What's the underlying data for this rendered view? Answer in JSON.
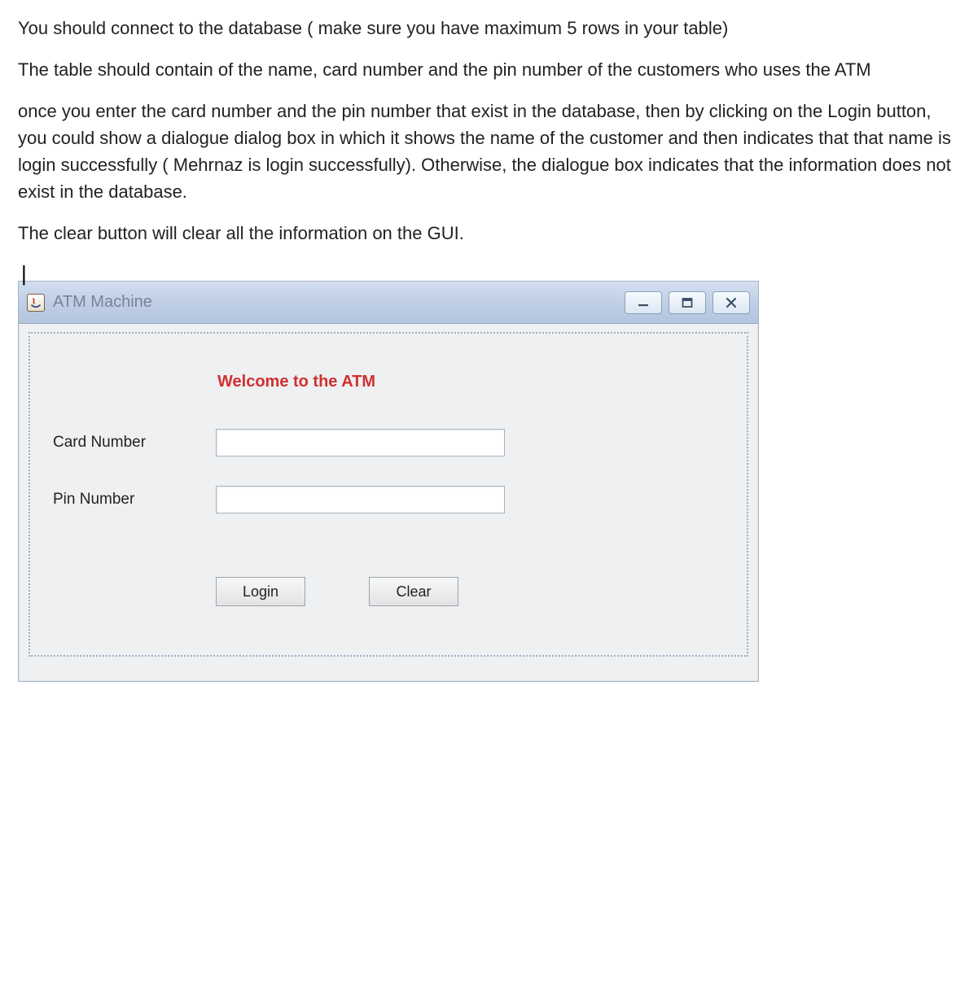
{
  "instructions": {
    "p1": "You should connect to the database ( make sure you have maximum 5 rows in your table)",
    "p2": "The table should contain of the name, card number and the pin number of the customers who uses the ATM",
    "p3": "once you enter the card number and the pin number that exist in the database, then by clicking on the Login button, you could show a dialogue dialog box in which it shows the name of the customer and then indicates that that name is login successfully ( Mehrnaz is login successfully). Otherwise, the dialogue box indicates that the information does not exist in the database.",
    "p4": "The clear button will clear all the information on the GUI."
  },
  "cursor": "|",
  "window": {
    "title": "ATM Machine",
    "welcome": "Welcome to the ATM",
    "labels": {
      "card": "Card Number",
      "pin": "Pin Number"
    },
    "inputs": {
      "card_value": "",
      "pin_value": ""
    },
    "buttons": {
      "login": "Login",
      "clear": "Clear"
    }
  }
}
